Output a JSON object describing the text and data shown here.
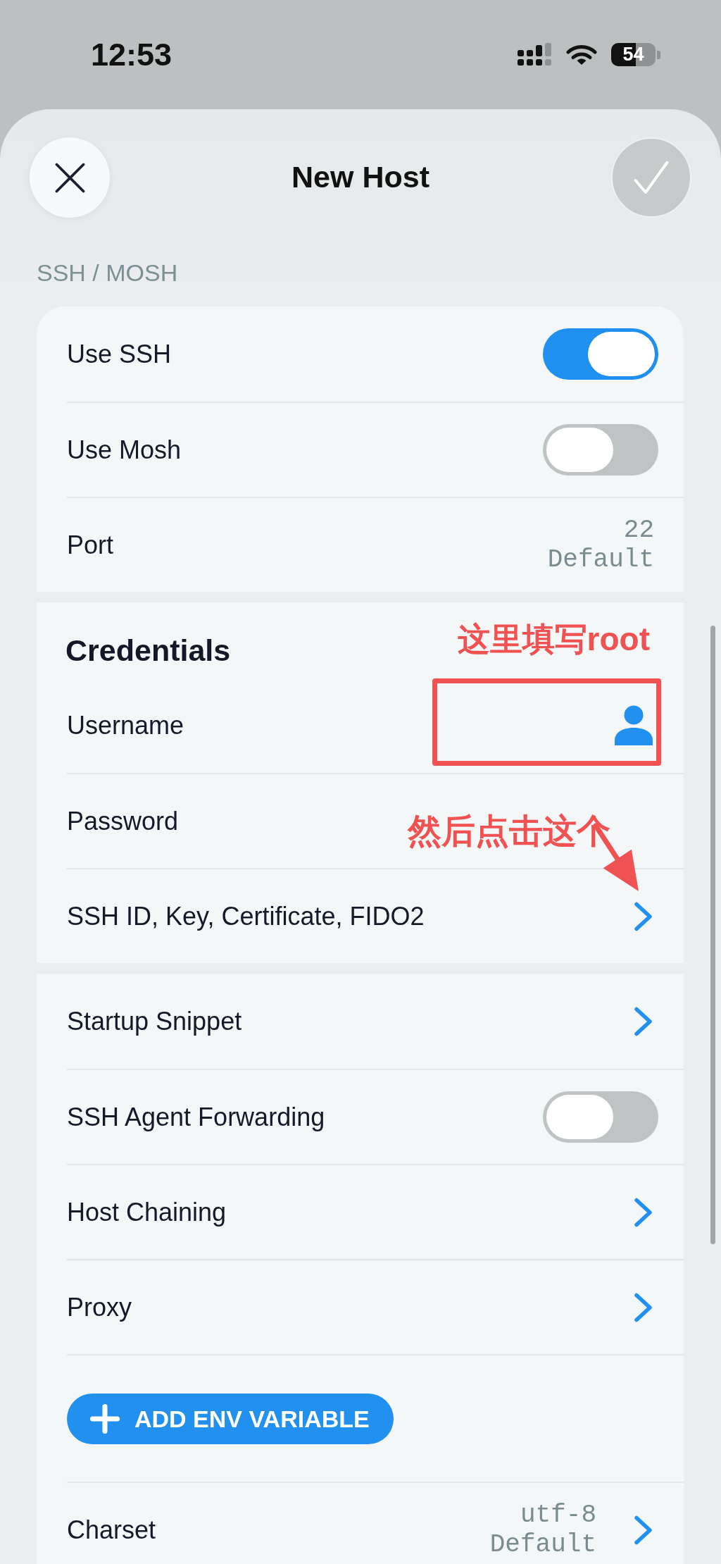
{
  "status_bar": {
    "time": "12:53",
    "battery": "54"
  },
  "header": {
    "title": "New Host",
    "save_disabled": true
  },
  "sections": [
    {
      "heading": "SSH / MOSH",
      "rows": [
        {
          "kind": "toggle",
          "label": "Use SSH",
          "on": true
        },
        {
          "kind": "toggle",
          "label": "Use Mosh",
          "on": false
        },
        {
          "kind": "value",
          "label": "Port",
          "value": "22",
          "hint": "Default"
        }
      ]
    },
    {
      "title": "Credentials",
      "rows": [
        {
          "kind": "field",
          "label": "Username",
          "picker": true
        },
        {
          "kind": "field",
          "label": "Password"
        },
        {
          "kind": "link",
          "label": "SSH ID, Key, Certificate, FIDO2"
        }
      ],
      "annotations": [
        {
          "kind": "note",
          "text": "这里填写root"
        },
        {
          "kind": "box"
        },
        {
          "kind": "note",
          "text": "然后点击这个"
        },
        {
          "kind": "arrow"
        }
      ]
    },
    {
      "rows": [
        {
          "kind": "link",
          "label": "Startup Snippet"
        },
        {
          "kind": "toggle",
          "label": "SSH Agent Forwarding",
          "on": false
        },
        {
          "kind": "link",
          "label": "Host Chaining"
        },
        {
          "kind": "link",
          "label": "Proxy"
        },
        {
          "kind": "button",
          "label": "ADD ENV VARIABLE"
        },
        {
          "kind": "link",
          "label": "Charset",
          "value": "utf-8",
          "hint": "Default"
        }
      ]
    }
  ]
}
